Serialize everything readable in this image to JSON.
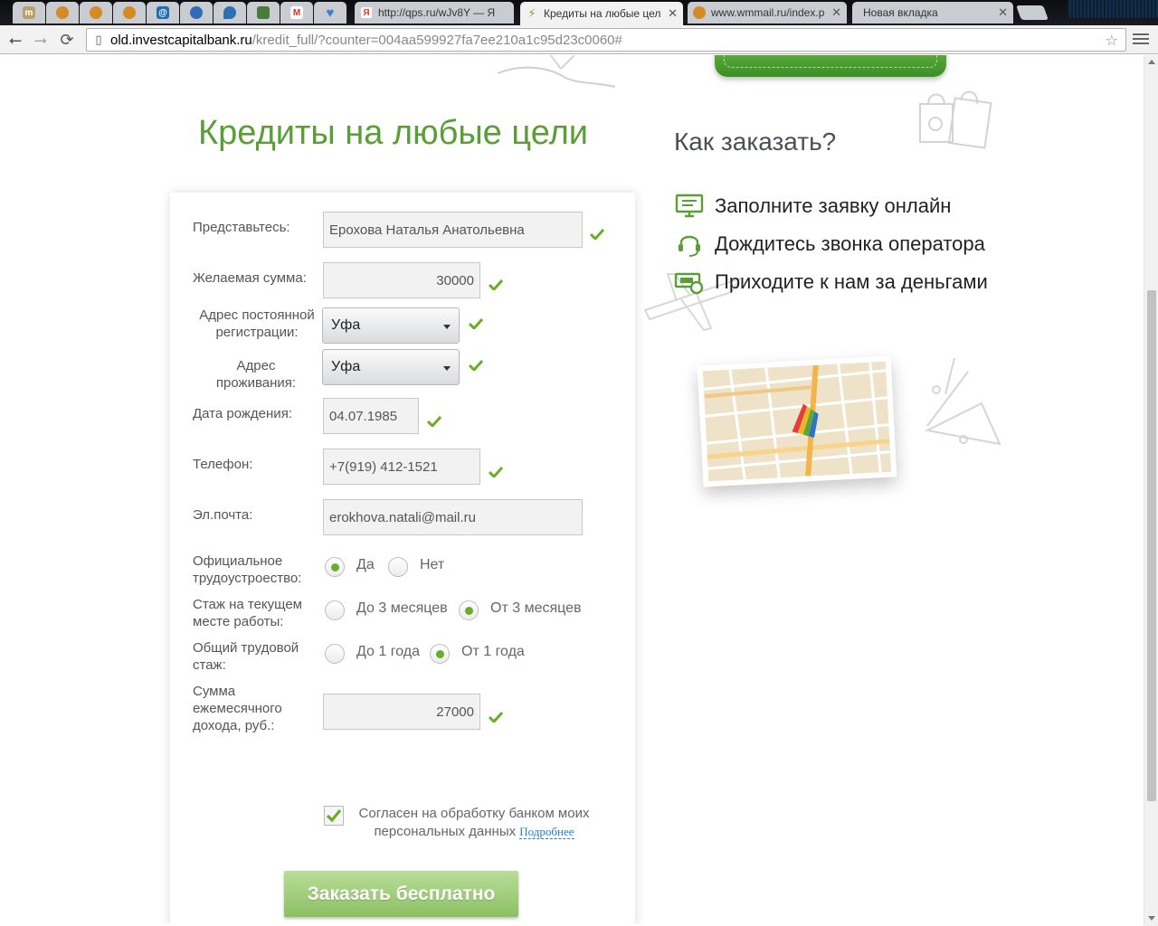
{
  "browser": {
    "tabs": [
      {
        "icon": "m-site-icon",
        "color": "#b7a36a",
        "title": ""
      },
      {
        "icon": "wmmail-icon",
        "color": "#d48a25",
        "title": ""
      },
      {
        "icon": "wmmail-icon",
        "color": "#d48a25",
        "title": ""
      },
      {
        "icon": "wmmail-icon",
        "color": "#d48a25",
        "title": ""
      },
      {
        "icon": "at-icon",
        "color": "#1f6fb0",
        "title": ""
      },
      {
        "icon": "globe-icon",
        "color": "#2f6db6",
        "title": ""
      },
      {
        "icon": "location-icon",
        "color": "#2d6fb5",
        "title": ""
      },
      {
        "icon": "image-icon",
        "color": "#4a7a3d",
        "title": ""
      },
      {
        "icon": "gmail-icon",
        "color": "#d93025",
        "title": ""
      },
      {
        "icon": "heart-icon",
        "color": "#3a7fd0",
        "title": ""
      },
      {
        "icon": "yandex-icon",
        "color": "#e23b2e",
        "title": "http://qps.ru/wJv8Y — Я"
      },
      {
        "icon": "investcapital-icon",
        "color": "#6aae27",
        "title": "Кредиты на любые цел",
        "active": true
      },
      {
        "icon": "wmmail-icon",
        "color": "#d48a25",
        "title": "www.wmmail.ru/index.p"
      },
      {
        "icon": "",
        "color": "",
        "title": "Новая вкладка"
      }
    ],
    "url_host": "old.investcapitalbank.ru",
    "url_path": "/kredit_full/?counter=004aa599927fa7ee210a1c95d23c0060#"
  },
  "page": {
    "title": "Кредиты на любые цели",
    "how_title": "Как заказать?",
    "steps": [
      {
        "icon": "monitor-icon",
        "text": "Заполните заявку онлайн"
      },
      {
        "icon": "headset-icon",
        "text": "Дождитесь звонка оператора"
      },
      {
        "icon": "money-icon",
        "text": "Приходите к нам за деньгами"
      }
    ]
  },
  "form": {
    "name_label": "Представьтесь:",
    "name_value": "Ерохова Наталья Анатольевна",
    "amount_label": "Желаемая сумма:",
    "amount_value": "30000",
    "reg_label": "Адрес постоянной регистрации:",
    "reg_value": "Уфа",
    "live_label": "Адрес проживания:",
    "live_value": "Уфа",
    "birth_label": "Дата рождения:",
    "birth_value": "04.07.1985",
    "phone_label": "Телефон:",
    "phone_value": "+7(919) 412-1521",
    "email_label": "Эл.почта:",
    "email_value": "erokhova.natali@mail.ru",
    "official_label": "Официальное трудоустроество:",
    "official_options": [
      "Да",
      "Нет"
    ],
    "official_selected": "Да",
    "tenure_label": "Стаж на текущем месте работы:",
    "tenure_options": [
      "До 3 месяцев",
      "От 3 месяцев"
    ],
    "tenure_selected": "От 3 месяцев",
    "total_label": "Общий трудовой стаж:",
    "total_options": [
      "До 1 года",
      "От 1 года"
    ],
    "total_selected": "От 1 года",
    "income_label": "Сумма ежемесячного дохода, руб.:",
    "income_value": "27000",
    "consent_text": "Согласен на обработку банком моих персональных данных",
    "consent_link": "Подробнее",
    "consent_checked": true,
    "submit_label": "Заказать бесплатно"
  },
  "colors": {
    "accent": "#5a9e36",
    "check": "#6aae27",
    "button": "#9fcc78"
  }
}
